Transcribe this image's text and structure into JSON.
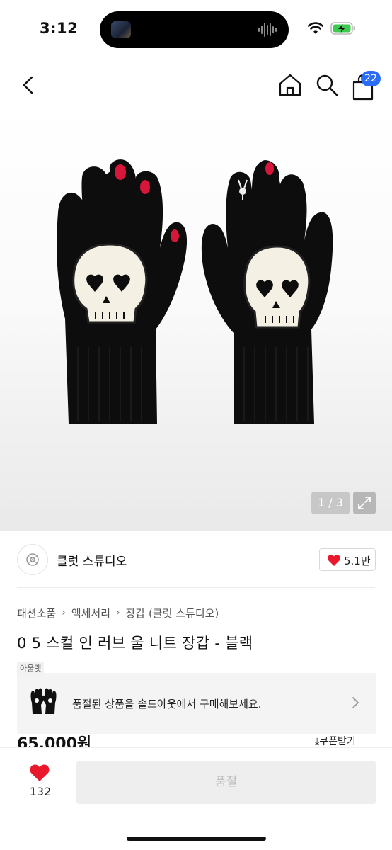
{
  "status_bar": {
    "time": "3:12"
  },
  "nav": {
    "cart_count": "22"
  },
  "hero": {
    "page_indicator": "1 / 3"
  },
  "store": {
    "name": "클럿 스튜디오",
    "like_count": "5.1만"
  },
  "breadcrumb": [
    "패션소품",
    "액세서리",
    "장갑 (클럿 스튜디오)"
  ],
  "product": {
    "title": "0 5 스컬 인 러브 울 니트 장갑 - 블랙",
    "price": "65,000원"
  },
  "outlet": {
    "tag": "아울렛",
    "banner_text": "품절된 상품을 솔드아웃에서 구매해보세요."
  },
  "coupon": {
    "label": "쿠폰받기"
  },
  "bottom_bar": {
    "wish_count": "132",
    "buy_button_label": "품절"
  },
  "colors": {
    "accent_blue": "#2a6df4",
    "heart_red": "#e8192c",
    "gem_red": "#d6163a"
  }
}
